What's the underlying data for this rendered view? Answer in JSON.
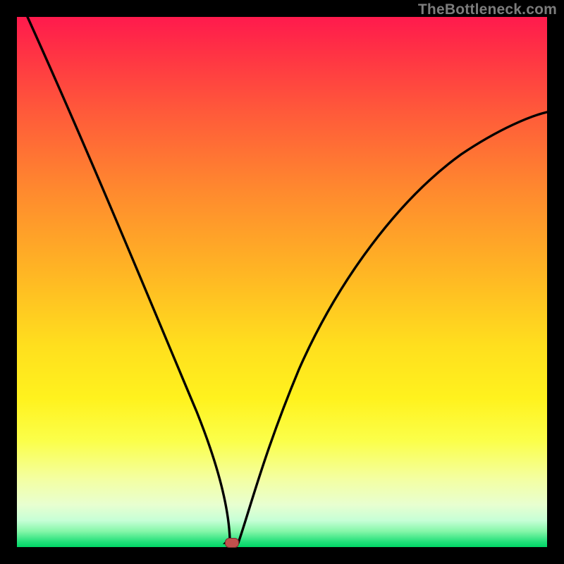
{
  "watermark": {
    "text": "TheBottleneck.com"
  },
  "chart_data": {
    "type": "line",
    "title": "",
    "xlabel": "",
    "ylabel": "",
    "xlim": [
      0,
      100
    ],
    "ylim": [
      0,
      100
    ],
    "grid": false,
    "legend": false,
    "background_gradient": {
      "direction": "vertical",
      "stops": [
        {
          "pos": 0.0,
          "color": "#ff1a4d"
        },
        {
          "pos": 0.33,
          "color": "#ff8a2e"
        },
        {
          "pos": 0.62,
          "color": "#ffdf1e"
        },
        {
          "pos": 0.87,
          "color": "#f4ffa0"
        },
        {
          "pos": 1.0,
          "color": "#00d665"
        }
      ]
    },
    "series": [
      {
        "name": "v-curve",
        "x": [
          0,
          5,
          10,
          15,
          20,
          25,
          30,
          33,
          35,
          37,
          39,
          40,
          42,
          45,
          50,
          55,
          60,
          65,
          70,
          75,
          80,
          85,
          90,
          95,
          100
        ],
        "y": [
          100,
          87,
          75,
          63,
          51,
          39,
          26,
          17,
          10,
          4,
          1,
          0,
          3,
          10,
          22,
          33,
          43,
          51,
          58,
          64,
          69,
          73,
          76,
          78,
          80
        ]
      }
    ],
    "marker": {
      "x": 40,
      "y": 0,
      "color": "#c0504d",
      "shape": "rounded-rect"
    }
  }
}
